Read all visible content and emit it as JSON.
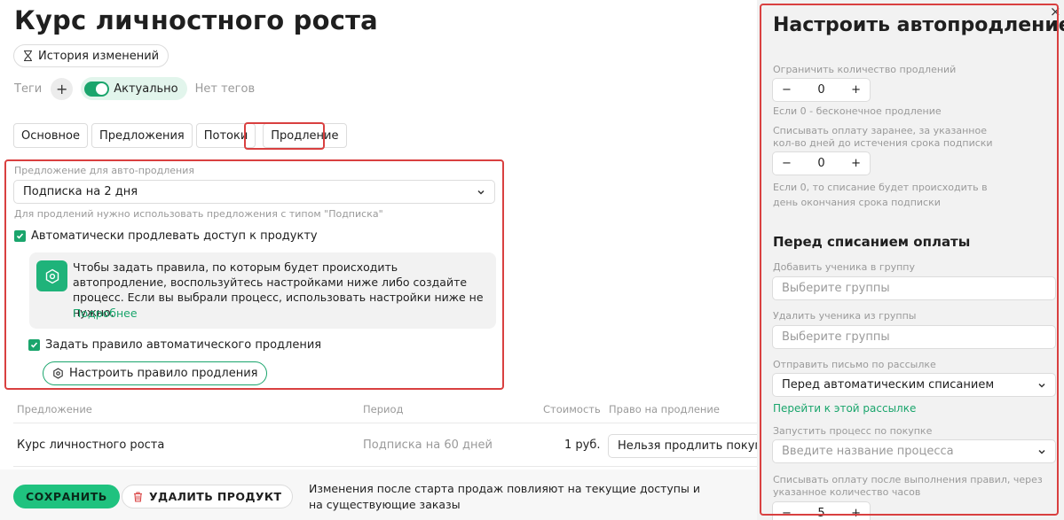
{
  "page": {
    "title": "Курс личностного роста",
    "history_label": "История изменений",
    "tags_label": "Теги",
    "tag_add": "+",
    "status_label": "Актуально",
    "no_tags": "Нет тегов"
  },
  "tabs": [
    {
      "label": "Основное"
    },
    {
      "label": "Предложения"
    },
    {
      "label": "Потоки"
    },
    {
      "label": "Продление",
      "active": true
    }
  ],
  "renewal": {
    "offer_label": "Предложение для авто-продления",
    "offer_value": "Подписка на 2 дня",
    "offer_hint": "Для продлений нужно использовать предложения с типом \"Подписка\"",
    "auto_renew_label": "Автоматически продлевать доступ к продукту",
    "auto_renew_checked": true,
    "info_text": "Чтобы задать правила, по которым будет происходить автопродление, воспользуйтесь настройками ниже либо создайте процесс. Если вы выбрали процесс, использовать настройки ниже не нужно.",
    "info_link": "Подробнее",
    "rule_label": "Задать правило автоматического продления",
    "rule_checked": true,
    "configure_button": "Настроить правило продления"
  },
  "table": {
    "headers": [
      "Предложение",
      "Период",
      "Стоимость",
      "Право на продление"
    ],
    "rows": [
      {
        "offer": "Курс личностного роста",
        "period": "Подписка на 60 дней",
        "price": "1 руб.",
        "renewal_right": "Нельзя продлить покуп"
      }
    ]
  },
  "footer": {
    "save_label": "СОХРАНИТЬ",
    "delete_label": "УДАЛИТЬ ПРОДУКТ",
    "note": "Изменения после старта продаж повлияют на текущие доступы и на существующие заказы"
  },
  "panel": {
    "title": "Настроить автопродление",
    "close": "×",
    "limit_label": "Ограничить количество продлений",
    "limit_value": "0",
    "limit_hint": "Если 0 - бесконечное продление",
    "advance_label_1": "Списывать оплату заранее, за указанное",
    "advance_label_2": "кол-во дней до истечения срока подписки",
    "advance_value": "0",
    "advance_hint_1": "Если 0, то списание будет происходить в",
    "advance_hint_2": "день окончания срока подписки",
    "before_title": "Перед списанием оплаты",
    "add_group_label": "Добавить ученика в группу",
    "add_group_placeholder": "Выберите группы",
    "remove_group_label": "Удалить ученика из группы",
    "remove_group_placeholder": "Выберите группы",
    "mailing_label": "Отправить письмо по рассылке",
    "mailing_value": "Перед автоматическим списанием",
    "mailing_link": "Перейти к этой рассылке",
    "process_label": "Запустить процесс по покупке",
    "process_placeholder": "Введите название процесса",
    "after_label_1": "Списывать оплату после выполнения правил, через",
    "after_label_2": "указанное количество часов",
    "after_value": "5",
    "minus": "−",
    "plus": "+"
  },
  "colors": {
    "accent": "#1aa56c",
    "highlight": "#d94040",
    "panel_bg": "#f2f2f2"
  }
}
